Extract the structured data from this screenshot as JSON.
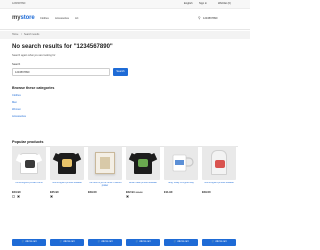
{
  "topbar": {
    "phone": "1234567890",
    "language": "English",
    "signin": "Sign in",
    "wishlist": "Wishlist (0)"
  },
  "header": {
    "logo_prefix": "my",
    "logo_suffix": "store",
    "nav": [
      "Clothes",
      "Accessories",
      "Art"
    ],
    "search_value": "1234567890"
  },
  "breadcrumb": {
    "home": "Home",
    "separator": "/",
    "current": "Search results"
  },
  "main": {
    "heading": "No search results for \"1234567890\"",
    "subtext": "Search again what you are looking for",
    "search_label": "Search",
    "search_value": "1234567890",
    "search_button": "Search",
    "browse_heading": "Browse these categories",
    "categories": [
      "Clothes",
      "Men",
      "Women",
      "Accessories"
    ]
  },
  "popular": {
    "heading": "Popular products",
    "add_to_cart": "Add to cart",
    "products": [
      {
        "name": "Hummingbird printed t-shirt",
        "price": "€23.90",
        "old_price": "",
        "image": "tshirt-white",
        "swatches": [
          "#ffffff",
          "#222222"
        ]
      },
      {
        "name": "Hummingbird printed sweater",
        "price": "€35.90",
        "old_price": "",
        "image": "tshirt-black",
        "swatches": [
          "#222222"
        ]
      },
      {
        "name": "The best is yet to come' Framed poster",
        "price": "€29.00",
        "old_price": "",
        "image": "framed-poster",
        "swatches": []
      },
      {
        "name": "Brown bear printed sweater",
        "price": "€22.94",
        "old_price": "€28.68",
        "image": "tshirt-black-bear",
        "swatches": [
          "#222222"
        ]
      },
      {
        "name": "Mug Today is a good day",
        "price": "€11.90",
        "old_price": "",
        "image": "mug",
        "swatches": []
      },
      {
        "name": "Hummingbird printed sweater",
        "price": "€29.00",
        "old_price": "",
        "image": "hoodie-white",
        "swatches": []
      }
    ]
  },
  "colors": {
    "accent": "#1e6bd6",
    "background": "#ffffff",
    "tile": "#e9e9e9"
  }
}
